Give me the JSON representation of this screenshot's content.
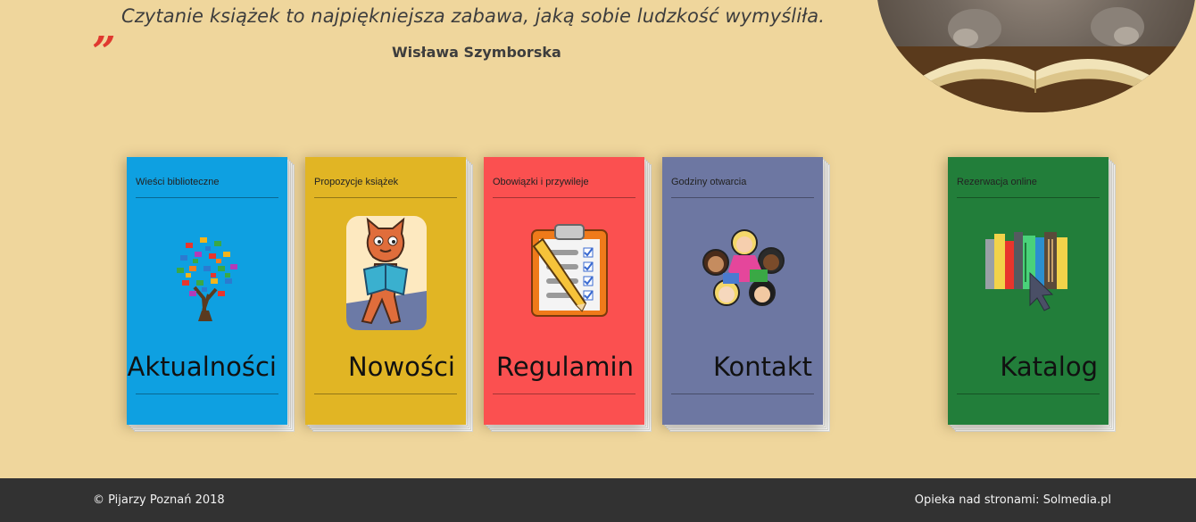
{
  "quote": {
    "open_mark": "„",
    "text": "Czytanie książek to najpiękniejsza zabawa, jaką sobie ludzkość wymyśliła.",
    "close_mark": "”",
    "author": "Wisława Szymborska"
  },
  "cards": [
    {
      "subtitle": "Wieści biblioteczne",
      "title": "Aktualności",
      "color": "#0ea0e1",
      "icon": "butterfly-tree-icon"
    },
    {
      "subtitle": "Propozycje książek",
      "title": "Nowości",
      "color": "#e1b524",
      "icon": "reading-cat-icon"
    },
    {
      "subtitle": "Obowiązki i przywileje",
      "title": "Regulamin",
      "color": "#fb5050",
      "icon": "clipboard-icon"
    },
    {
      "subtitle": "Godziny otwarcia",
      "title": "Kontakt",
      "color": "#6d77a2",
      "icon": "people-circle-icon"
    },
    {
      "subtitle": "Rezerwacja online",
      "title": "Katalog",
      "color": "#227e3a",
      "icon": "books-cursor-icon"
    }
  ],
  "footer": {
    "copyright": "© Pijarzy Poznań 2018",
    "care": "Opieka nad stronami: Solmedia.pl",
    "background": "#323232"
  }
}
